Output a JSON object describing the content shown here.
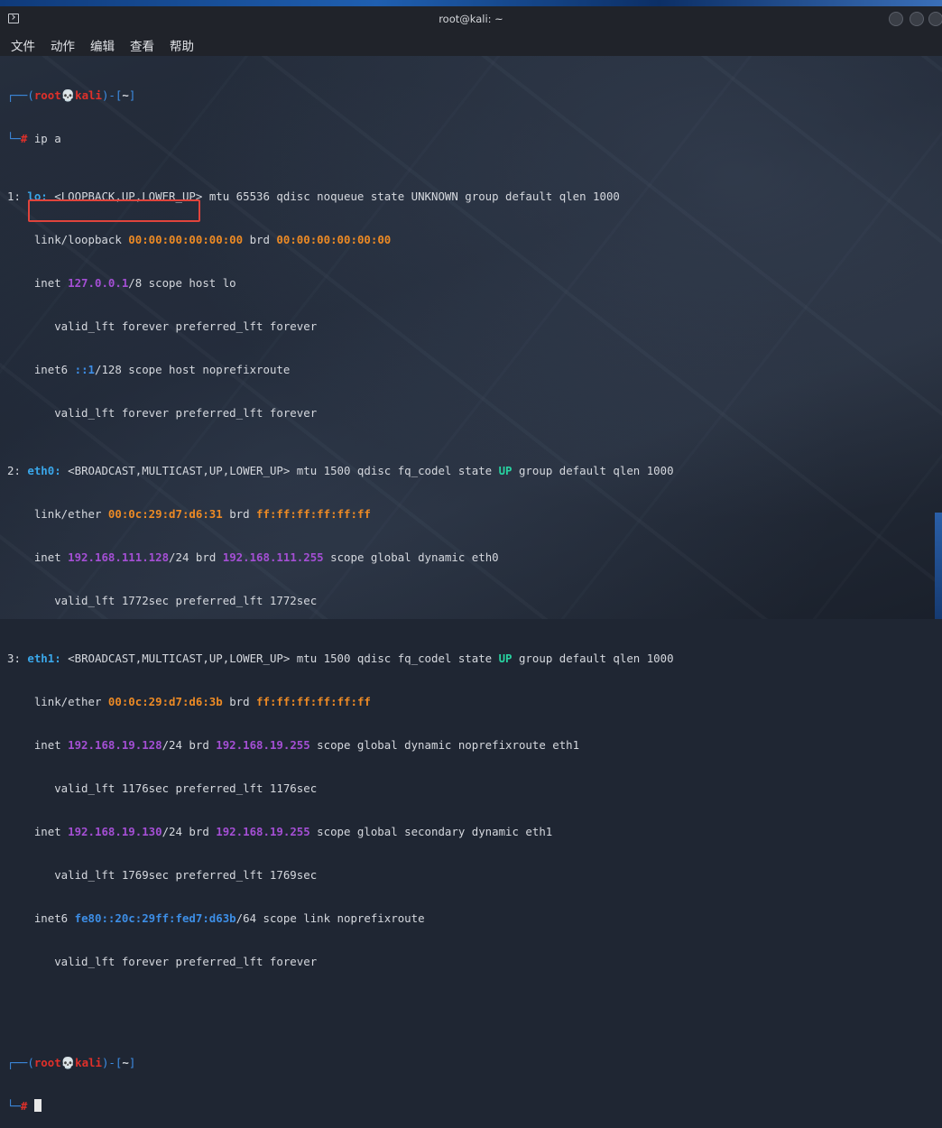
{
  "window": {
    "title": "root@kali: ~"
  },
  "menu": [
    "文件",
    "动作",
    "编辑",
    "查看",
    "帮助"
  ],
  "prompt": {
    "open": "┌──(",
    "user": "root",
    "skull": "💀",
    "host": "kali",
    "mid": ")-[",
    "dir": "~",
    "close": "]",
    "corner": "└─",
    "hash": "#"
  },
  "command": " ip a",
  "output": {
    "lo": {
      "num": "1: ",
      "name": "lo:",
      "rest": " <LOOPBACK,UP,LOWER_UP> mtu 65536 qdisc noqueue state UNKNOWN group default qlen 1000",
      "link_label": "    link/loopback ",
      "mac": "00:00:00:00:00:00",
      "brd_label": " brd ",
      "brd": "00:00:00:00:00:00",
      "inet_label": "    inet ",
      "ip": "127.0.0.1",
      "inet_rest": "/8 scope host lo",
      "valid1": "       valid_lft forever preferred_lft forever",
      "inet6_label": "    inet6 ",
      "ip6": "::1",
      "inet6_rest": "/128 scope host noprefixroute",
      "valid2": "       valid_lft forever preferred_lft forever"
    },
    "eth0": {
      "num": "2: ",
      "name": "eth0:",
      "rest1": " <BROADCAST,MULTICAST,UP,LOWER_UP> mtu 1500 qdisc fq_codel state ",
      "state": "UP",
      "rest2": " group default qlen 1000",
      "link_label": "    link/ether ",
      "mac": "00:0c:29:d7:d6:31",
      "brd_label": " brd ",
      "brd": "ff:ff:ff:ff:ff:ff",
      "inet_label": "    inet ",
      "ip": "192.168.111.128",
      "prefix": "/24",
      "brd2_label": " brd ",
      "brd2": "192.168.111.255",
      "inet_rest": " scope global dynamic eth0",
      "valid": "       valid_lft 1772sec preferred_lft 1772sec"
    },
    "eth1": {
      "num": "3: ",
      "name": "eth1:",
      "rest1": " <BROADCAST,MULTICAST,UP,LOWER_UP> mtu 1500 qdisc fq_codel state ",
      "state": "UP",
      "rest2": " group default qlen 1000",
      "link_label": "    link/ether ",
      "mac": "00:0c:29:d7:d6:3b",
      "brd_label": " brd ",
      "brd": "ff:ff:ff:ff:ff:ff",
      "inet1_label": "    inet ",
      "ip1": "192.168.19.128",
      "prefix1": "/24 brd ",
      "brd1": "192.168.19.255",
      "inet1_rest": " scope global dynamic noprefixroute eth1",
      "valid1": "       valid_lft 1176sec preferred_lft 1176sec",
      "inet2_label": "    inet ",
      "ip2": "192.168.19.130",
      "prefix2": "/24 brd ",
      "brd2": "192.168.19.255",
      "inet2_rest": " scope global secondary dynamic eth1",
      "valid2": "       valid_lft 1769sec preferred_lft 1769sec",
      "inet6_label": "    inet6 ",
      "ip6": "fe80::20c:29ff:fed7:d63b",
      "inet6_rest": "/64 scope link noprefixroute",
      "valid3": "       valid_lft forever preferred_lft forever"
    }
  },
  "colors": {
    "prompt_blue": "#3d8ee6",
    "prompt_red": "#e0302a",
    "mac_orange": "#ec8a25",
    "ip_purple": "#a44fd4",
    "iface_cyan": "#3aa7ea",
    "state_green": "#28d2a0",
    "highlight_box": "#e0443c"
  }
}
